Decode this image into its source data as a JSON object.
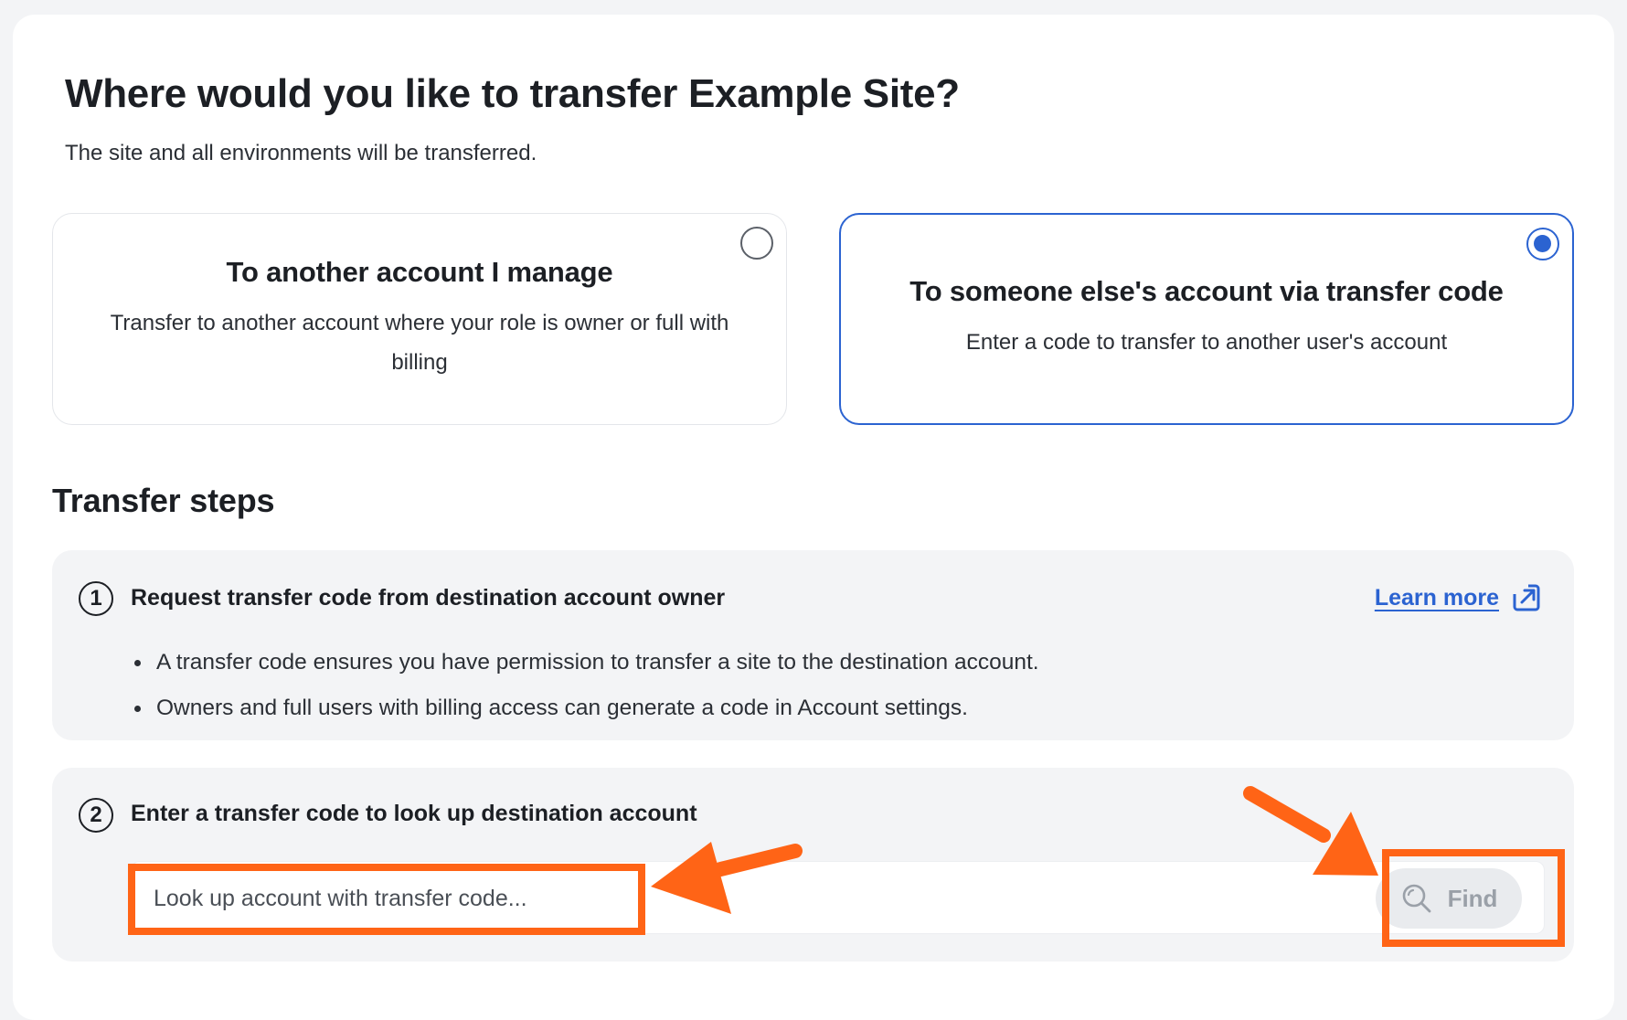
{
  "header": {
    "title": "Where would you like to transfer Example Site?",
    "subtitle": "The site and all environments will be transferred."
  },
  "options": [
    {
      "title": "To another account I manage",
      "description": "Transfer to another account where your role is owner or full with billing",
      "selected": false
    },
    {
      "title": "To someone else's account via transfer code",
      "description": "Enter a code to transfer to another user's account",
      "selected": true
    }
  ],
  "steps_section": {
    "title": "Transfer steps",
    "step1": {
      "number": "1",
      "heading": "Request transfer code from destination account owner",
      "learn_more": "Learn more",
      "bullets": [
        "A transfer code ensures you have permission to transfer a site to the destination account.",
        "Owners and full users with billing access can generate a code in Account settings."
      ]
    },
    "step2": {
      "number": "2",
      "heading": "Enter a transfer code to look up destination account",
      "input_placeholder": "Look up account with transfer code...",
      "input_value": "",
      "find_label": "Find"
    }
  },
  "colors": {
    "accent": "#2b63d1",
    "annotation": "#ff6416",
    "panel_bg": "#f3f4f6"
  },
  "icons": {
    "external_link": "external-link-icon",
    "search": "search-icon"
  }
}
